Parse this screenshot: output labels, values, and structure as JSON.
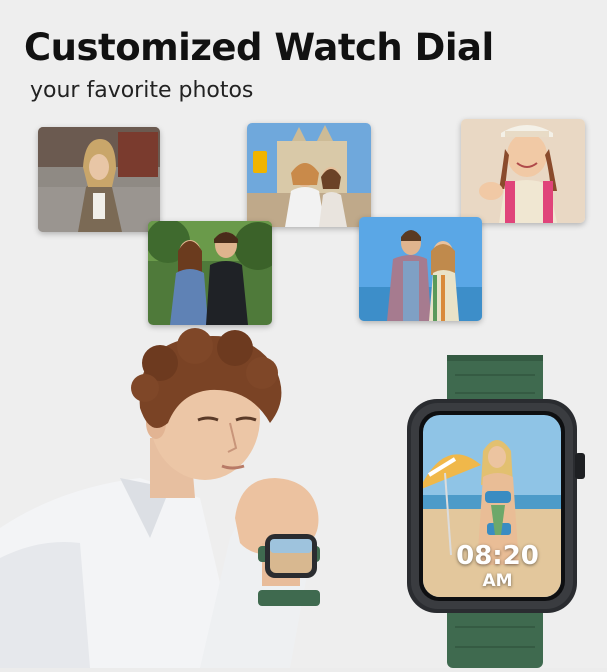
{
  "header": {
    "title": "Customized Watch Dial",
    "subtitle": "your favorite photos"
  },
  "watch": {
    "time": "08:20",
    "ampm": "AM"
  },
  "colors": {
    "band": "#3f6a4f",
    "case": "#2a2c30",
    "background": "#eeeeee"
  }
}
